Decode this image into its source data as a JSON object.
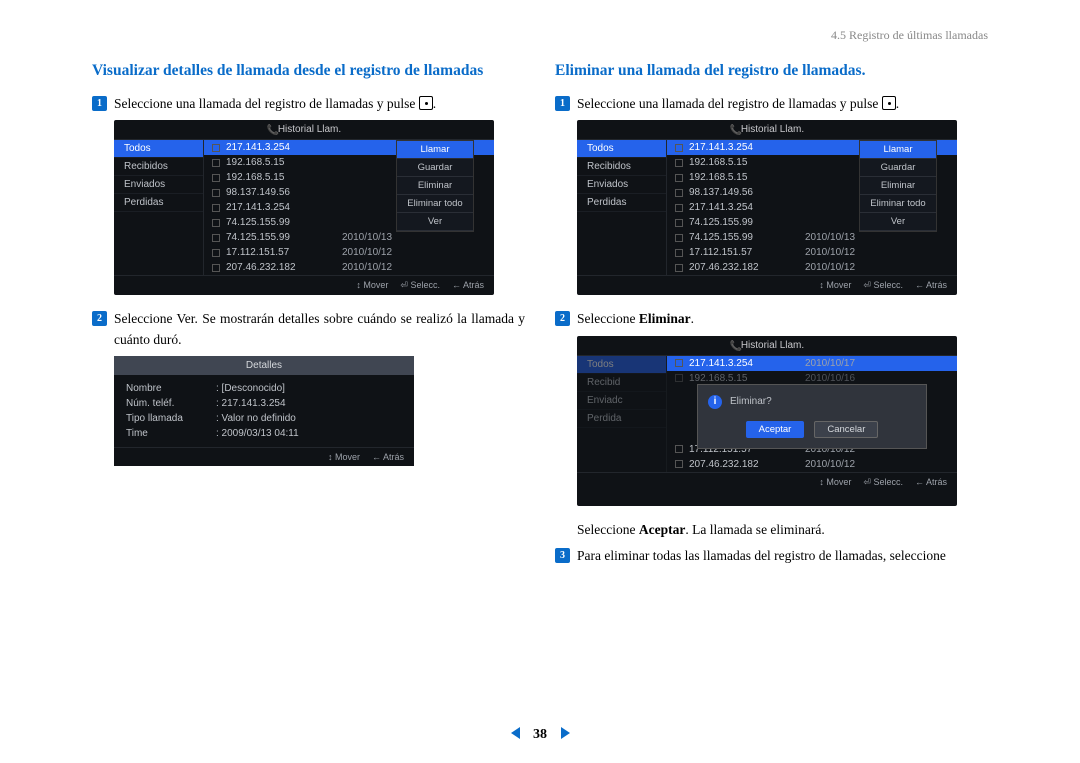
{
  "breadcrumb": "4.5 Registro de últimas llamadas",
  "left": {
    "title": "Visualizar detalles de llamada desde el registro de llamadas",
    "step1": "Seleccione una llamada del registro de llamadas y pulse ",
    "step1_tail": ".",
    "step2": "Seleccione Ver. Se mostrarán detalles sobre cuándo se realizó la llamada y cuánto duró."
  },
  "right": {
    "title": "Eliminar una llamada del registro de llamadas.",
    "step1": "Seleccione una llamada del registro de llamadas y pulse ",
    "step1_tail": ".",
    "step2_pre": "Seleccione ",
    "step2_bold": "Eliminar",
    "step2_post": ".",
    "after2_pre": "Seleccione ",
    "after2_bold": "Aceptar",
    "after2_post": ". La llamada se eliminará.",
    "step3": "Para eliminar todas las llamadas del registro de llamadas, seleccione"
  },
  "sim": {
    "title": "Historial Llam.",
    "sidebar": [
      "Todos",
      "Recibidos",
      "Enviados",
      "Perdidas"
    ],
    "rows": [
      {
        "ip": "217.141.3.254",
        "date": ""
      },
      {
        "ip": "192.168.5.15",
        "date": ""
      },
      {
        "ip": "192.168.5.15",
        "date": ""
      },
      {
        "ip": "98.137.149.56",
        "date": ""
      },
      {
        "ip": "217.141.3.254",
        "date": ""
      },
      {
        "ip": "74.125.155.99",
        "date": ""
      },
      {
        "ip": "74.125.155.99",
        "date": "2010/10/13"
      },
      {
        "ip": "17.112.151.57",
        "date": "2010/10/12"
      },
      {
        "ip": "207.46.232.182",
        "date": "2010/10/12"
      }
    ],
    "menu": [
      "Llamar",
      "Guardar",
      "Eliminar",
      "Eliminar todo",
      "Ver"
    ],
    "footer": {
      "mover": "↕ Mover",
      "selecc": "⏎ Selecc.",
      "atras": "← Atrás"
    }
  },
  "details": {
    "title": "Detalles",
    "rows": [
      {
        "lbl": "Nombre",
        "val": ": [Desconocido]"
      },
      {
        "lbl": "Núm. teléf.",
        "val": ": 217.141.3.254"
      },
      {
        "lbl": "Tipo llamada",
        "val": ": Valor no definido"
      },
      {
        "lbl": "Time",
        "val": ": 2009/03/13  04:11"
      }
    ],
    "footer": {
      "mover": "↕ Mover",
      "atras": "← Atrás"
    }
  },
  "sim2": {
    "rows_top": [
      {
        "ip": "217.141.3.254",
        "date": "2010/10/17"
      },
      {
        "ip": "192.168.5.15",
        "date": "2010/10/16"
      }
    ],
    "rows_bottom": [
      {
        "ip": "17.112.151.57",
        "date": "2010/10/12"
      },
      {
        "ip": "207.46.232.182",
        "date": "2010/10/12"
      }
    ],
    "confirm_text": "Eliminar?",
    "btn_accept": "Aceptar",
    "btn_cancel": "Cancelar"
  },
  "page_number": "38"
}
